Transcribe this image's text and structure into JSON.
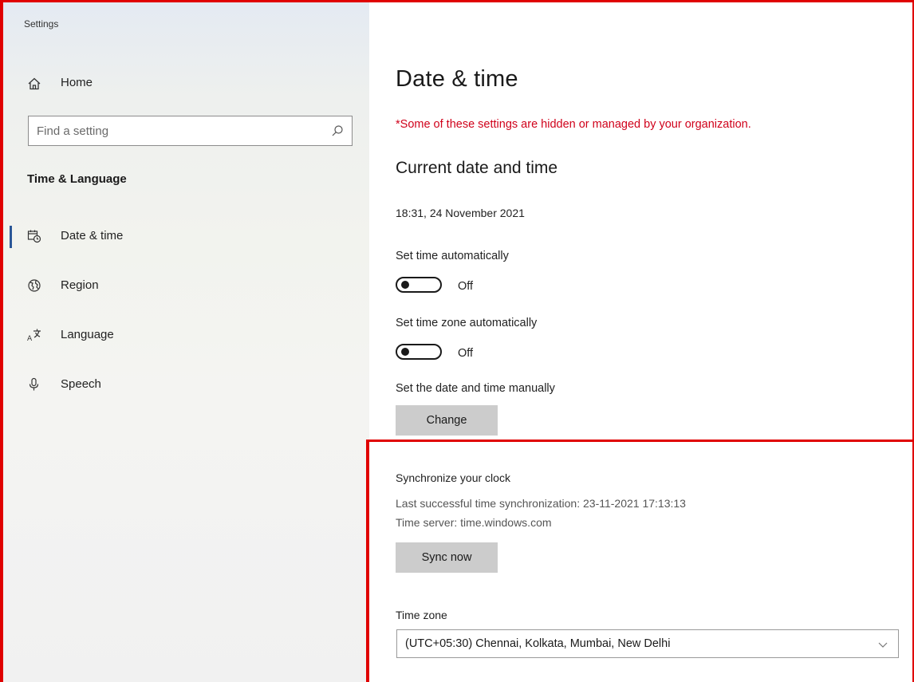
{
  "window": {
    "title": "Settings"
  },
  "sidebar": {
    "home_label": "Home",
    "search_placeholder": "Find a setting",
    "section_title": "Time & Language",
    "items": [
      {
        "label": "Date & time",
        "icon": "calendar-clock-icon",
        "active": true
      },
      {
        "label": "Region",
        "icon": "globe-icon",
        "active": false
      },
      {
        "label": "Language",
        "icon": "language-icon",
        "active": false
      },
      {
        "label": "Speech",
        "icon": "microphone-icon",
        "active": false
      }
    ]
  },
  "main": {
    "title": "Date & time",
    "notice": "*Some of these settings are hidden or managed by your organization.",
    "current_heading": "Current date and time",
    "current_datetime": "18:31, 24 November 2021",
    "set_time_auto_label": "Set time automatically",
    "set_time_auto_state": "Off",
    "set_timezone_auto_label": "Set time zone automatically",
    "set_timezone_auto_state": "Off",
    "manual_label": "Set the date and time manually",
    "change_button": "Change",
    "sync": {
      "heading": "Synchronize your clock",
      "last_sync": "Last successful time synchronization: 23-11-2021 17:13:13",
      "server": "Time server: time.windows.com",
      "button": "Sync now"
    },
    "timezone": {
      "label": "Time zone",
      "value": "(UTC+05:30) Chennai, Kolkata, Mumbai, New Delhi"
    }
  },
  "colors": {
    "notice": "#d0021b",
    "annotation_frame": "#e00000",
    "button_bg": "#cccccc"
  }
}
